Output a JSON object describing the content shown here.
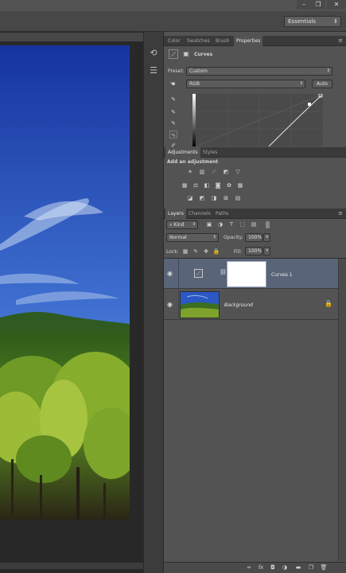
{
  "window": {
    "workspace": "Essentials",
    "controls": [
      "–",
      "❐",
      "✕"
    ]
  },
  "properties": {
    "tabs": [
      "Color",
      "Swatches",
      "Brush",
      "Properties"
    ],
    "active_tab": "Properties",
    "title": "Curves",
    "preset_label": "Preset:",
    "preset_value": "Custom",
    "channel_value": "RGB",
    "auto_label": "Auto"
  },
  "adjustments": {
    "tabs": [
      "Adjustments",
      "Styles"
    ],
    "heading": "Add an adjustment"
  },
  "layers": {
    "tabs": [
      "Layers",
      "Channels",
      "Paths"
    ],
    "filter_kind": "Kind",
    "blend_mode": "Normal",
    "opacity_label": "Opacity:",
    "opacity_value": "100%",
    "lock_label": "Lock:",
    "fill_label": "Fill:",
    "fill_value": "100%",
    "items": [
      {
        "name": "Curves 1",
        "selected": true
      },
      {
        "name": "Background",
        "selected": false
      }
    ]
  },
  "colors": {
    "panel_bg": "#535353",
    "selected_row": "#596478",
    "sky_top": "#1a3aa8",
    "sky_bottom": "#5a90dc"
  }
}
